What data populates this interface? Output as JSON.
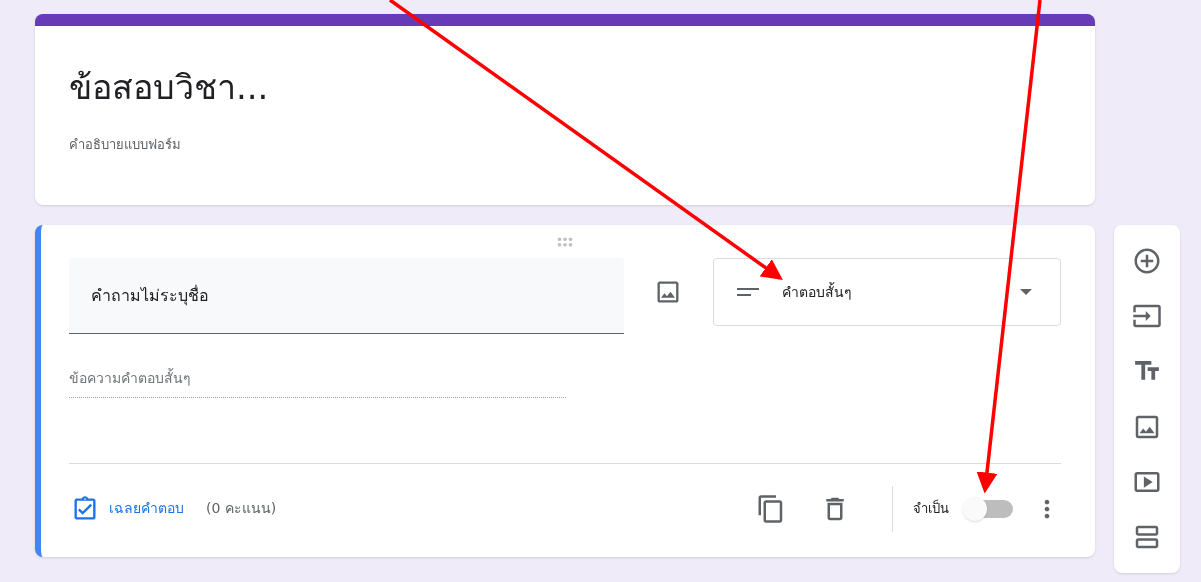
{
  "form": {
    "title": "ข้อสอบวิชา...",
    "description": "คำอธิบายแบบฟอร์ม"
  },
  "question": {
    "title": "คำถามไม่ระบุชื่อ",
    "answer_placeholder": "ข้อความคำตอบสั้นๆ",
    "type": "คำตอบสั้นๆ",
    "answer_key": "เฉลยคำตอบ",
    "points": "(0 คะแนน)",
    "required": {
      "label": "จำเป็น",
      "on": false
    }
  },
  "annotations": [
    {
      "kind": "arrow"
    },
    {
      "kind": "arrow"
    }
  ]
}
